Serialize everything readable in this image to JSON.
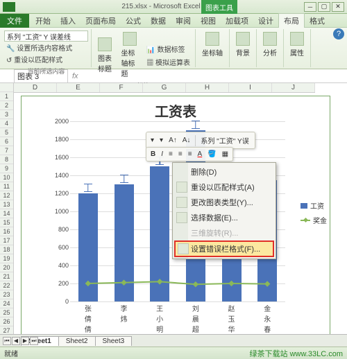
{
  "titlebar": {
    "title": "215.xlsx - Microsoft Excel",
    "chart_tools": "图表工具"
  },
  "tabs": {
    "file": "文件",
    "home": "开始",
    "insert": "插入",
    "page": "页面布局",
    "formula": "公式",
    "data": "数据",
    "review": "审阅",
    "view": "视图",
    "addin": "加载项",
    "design": "设计",
    "layout": "布局",
    "format": "格式"
  },
  "ribbon": {
    "series_dd": "系列 \"工资\" Y 误差线",
    "fmt_sel": "设置所选内容格式",
    "reset": "重设以匹配样式",
    "group_sel": "当前所选内容",
    "chart_title": "图表标题",
    "axis_title": "坐标轴标题",
    "data_label": "数据标签",
    "sim_table": "模拟运算表",
    "group_labels": "标签",
    "axes": "坐标轴",
    "bg": "背景",
    "analysis": "分析",
    "props": "属性"
  },
  "namebox": "图表 3",
  "cols": [
    "D",
    "E",
    "F",
    "G",
    "H",
    "I",
    "J"
  ],
  "chart_data": {
    "type": "bar+line",
    "title": "工资表",
    "categories": [
      "张倩倩",
      "李炜",
      "王小明",
      "刘晨超",
      "赵玉华",
      "金永春"
    ],
    "series": [
      {
        "name": "工资",
        "type": "bar",
        "color": "#4a72b8",
        "values": [
          1200,
          1300,
          1500,
          1900,
          1400,
          1350
        ]
      },
      {
        "name": "奖金",
        "type": "line",
        "color": "#8ab858",
        "values": [
          200,
          210,
          220,
          190,
          200,
          195
        ]
      }
    ],
    "ylim": [
      0,
      2000
    ],
    "ystep": 200,
    "ylabel": "",
    "xlabel": ""
  },
  "legend": {
    "bar": "工资",
    "line": "奖金"
  },
  "mini_toolbar": {
    "series_label": "系列 \"工资\" Y误"
  },
  "context_menu": {
    "delete": "删除(D)",
    "reset_style": "重设以匹配样式(A)",
    "change_type": "更改图表类型(Y)...",
    "select_data": "选择数据(E)...",
    "rotate_3d": "三维旋转(R)...",
    "fmt_error": "设置错误栏格式(F)..."
  },
  "sheets": [
    "Sheet1",
    "Sheet2",
    "Sheet3"
  ],
  "status": {
    "ready": "就绪",
    "watermark": "绿茶下载站 www.33LC.com"
  }
}
